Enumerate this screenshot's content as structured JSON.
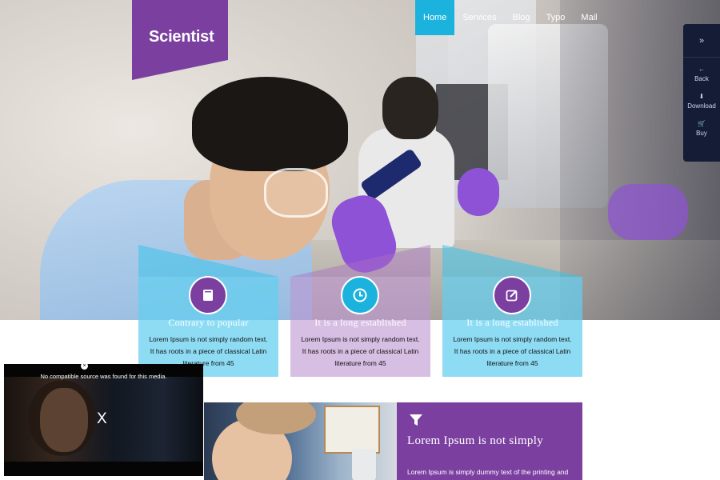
{
  "brand": {
    "logo_text": "Scientist"
  },
  "nav": {
    "items": [
      {
        "label": "Home",
        "active": true
      },
      {
        "label": "Services",
        "active": false
      },
      {
        "label": "Blog",
        "active": false
      },
      {
        "label": "Typo",
        "active": false
      },
      {
        "label": "Mail",
        "active": false
      }
    ]
  },
  "side_panel": {
    "toggle_icon": "chevrons-right-icon",
    "buttons": [
      {
        "label": "Back",
        "icon": "arrow-left-icon"
      },
      {
        "label": "Download",
        "icon": "download-icon"
      },
      {
        "label": "Buy",
        "icon": "cart-icon"
      }
    ]
  },
  "features": [
    {
      "title": "Contrary to popular",
      "desc": "Lorem Ipsum is not simply random text. It has roots in a piece of classical Latin literature from 45",
      "icon": "book-icon",
      "theme": "cyan"
    },
    {
      "title": "It is a long established",
      "desc": "Lorem Ipsum is not simply random text. It has roots in a piece of classical Latin literature from 45",
      "icon": "clock-icon",
      "theme": "purple"
    },
    {
      "title": "It is a long established",
      "desc": "Lorem Ipsum is not simply random text. It has roots in a piece of classical Latin literature from 45",
      "icon": "edit-icon",
      "theme": "cyan"
    }
  ],
  "promo": {
    "icon": "funnel-icon",
    "title": "Lorem Ipsum is not simply",
    "text": "Lorem Ipsum is simply dummy text of the printing and"
  },
  "video_overlay": {
    "message": "No compatible source was found for this media.",
    "close_label": "X"
  },
  "colors": {
    "purple": "#7b3fa0",
    "cyan": "#1bb3dd",
    "panel": "#141d35"
  }
}
